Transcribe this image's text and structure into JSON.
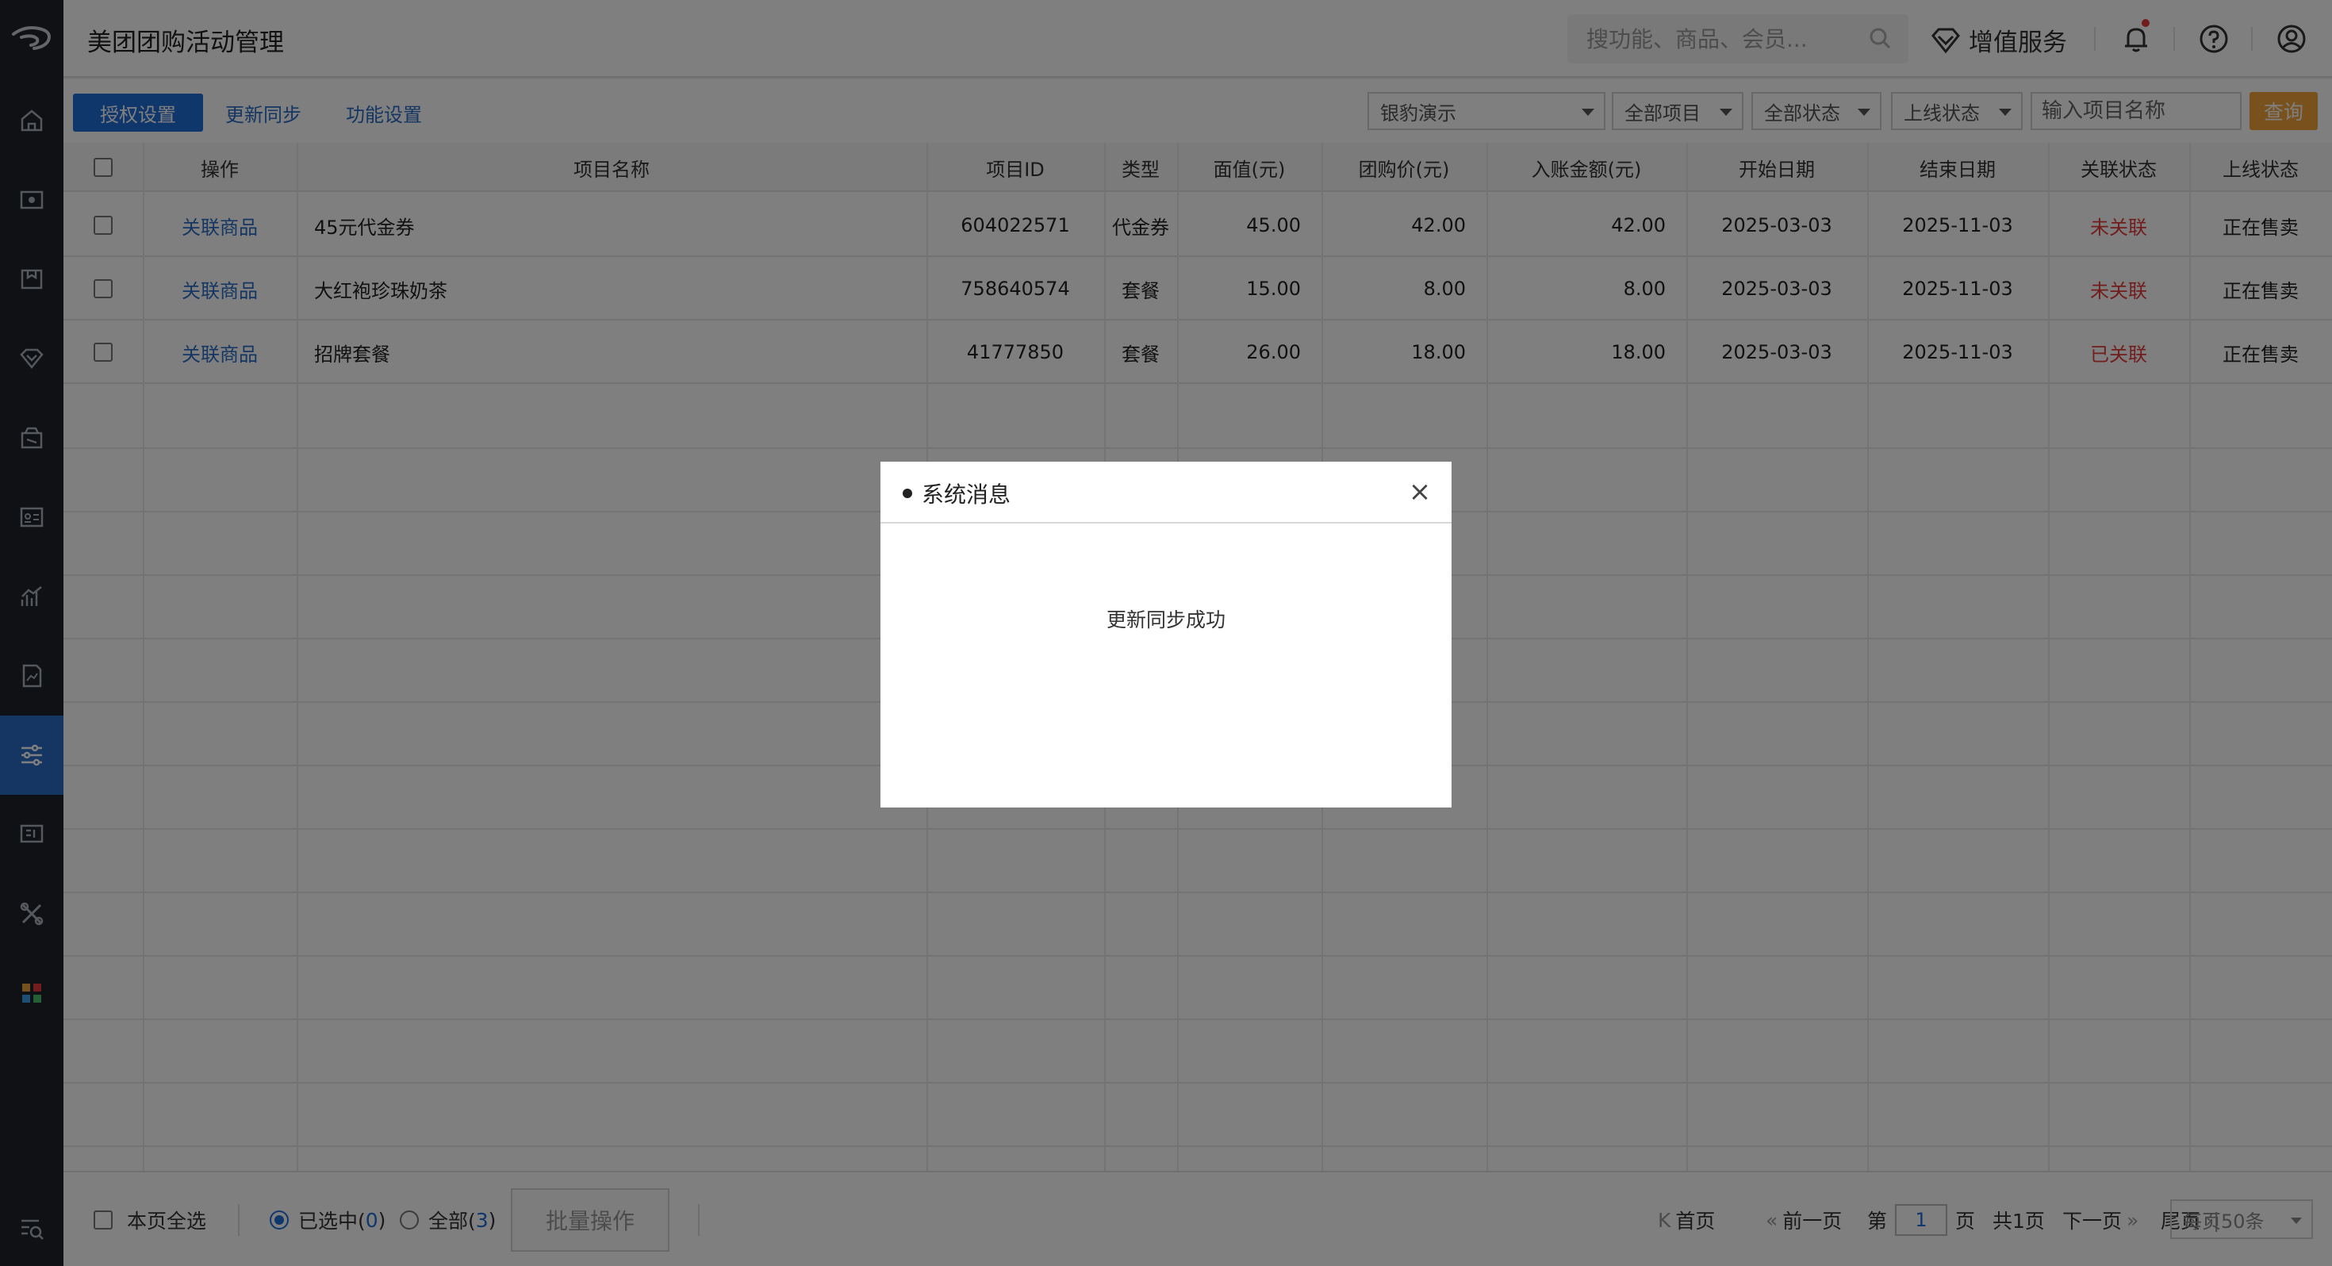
{
  "header": {
    "title": "美团团购活动管理",
    "search_placeholder": "搜功能、商品、会员...",
    "value_added": "增值服务"
  },
  "sidebar": {
    "items": [
      {
        "icon": "home-icon"
      },
      {
        "icon": "wallet-icon"
      },
      {
        "icon": "package-icon"
      },
      {
        "icon": "vip-diamond-icon"
      },
      {
        "icon": "store-icon"
      },
      {
        "icon": "member-card-icon"
      },
      {
        "icon": "analytics-icon"
      },
      {
        "icon": "report-icon"
      },
      {
        "icon": "settings-sliders-icon",
        "active": true
      },
      {
        "icon": "ad-icon"
      },
      {
        "icon": "tools-icon"
      },
      {
        "icon": "apps-grid-icon"
      },
      {
        "icon": "search-list-icon"
      }
    ]
  },
  "toolbar": {
    "auth_label": "授权设置",
    "sync_label": "更新同步",
    "func_label": "功能设置",
    "store_select": "银豹演示",
    "project_select": "全部项目",
    "status_select": "全部状态",
    "online_select": "上线状态",
    "name_placeholder": "输入项目名称",
    "query_label": "查询"
  },
  "table": {
    "headers": [
      "操作",
      "项目名称",
      "项目ID",
      "类型",
      "面值(元)",
      "团购价(元)",
      "入账金额(元)",
      "开始日期",
      "结束日期",
      "关联状态",
      "上线状态"
    ],
    "rows": [
      {
        "action": "关联商品",
        "name": "45元代金券",
        "id": "604022571",
        "type": "代金券",
        "face": "45.00",
        "price": "42.00",
        "income": "42.00",
        "start": "2025-03-03",
        "end": "2025-11-03",
        "link": "未关联",
        "online": "正在售卖"
      },
      {
        "action": "关联商品",
        "name": "大红袍珍珠奶茶",
        "id": "758640574",
        "type": "套餐",
        "face": "15.00",
        "price": "8.00",
        "income": "8.00",
        "start": "2025-03-03",
        "end": "2025-11-03",
        "link": "未关联",
        "online": "正在售卖"
      },
      {
        "action": "关联商品",
        "name": "招牌套餐",
        "id": "41777850",
        "type": "套餐",
        "face": "26.00",
        "price": "18.00",
        "income": "18.00",
        "start": "2025-03-03",
        "end": "2025-11-03",
        "link": "已关联",
        "online": "正在售卖"
      }
    ]
  },
  "footer": {
    "select_page": "本页全选",
    "selected_label": "已选中(",
    "selected_count": "0",
    "all_label": "全部(",
    "all_count": "3",
    "close_paren": ")",
    "batch_label": "批量操作",
    "first": "首页",
    "prev": "前一页",
    "page_prefix": "第",
    "page_value": "1",
    "page_suffix": "页",
    "total_pages": "共1页",
    "next": "下一页",
    "last": "尾页",
    "per_page": "每页50条"
  },
  "modal": {
    "title": "系统消息",
    "message": "更新同步成功",
    "close": "×"
  },
  "colors": {
    "primary": "#1e6fd9",
    "query": "#f2a33a",
    "unlinked": "#e23b3b",
    "sidebar": "#1f2329"
  }
}
